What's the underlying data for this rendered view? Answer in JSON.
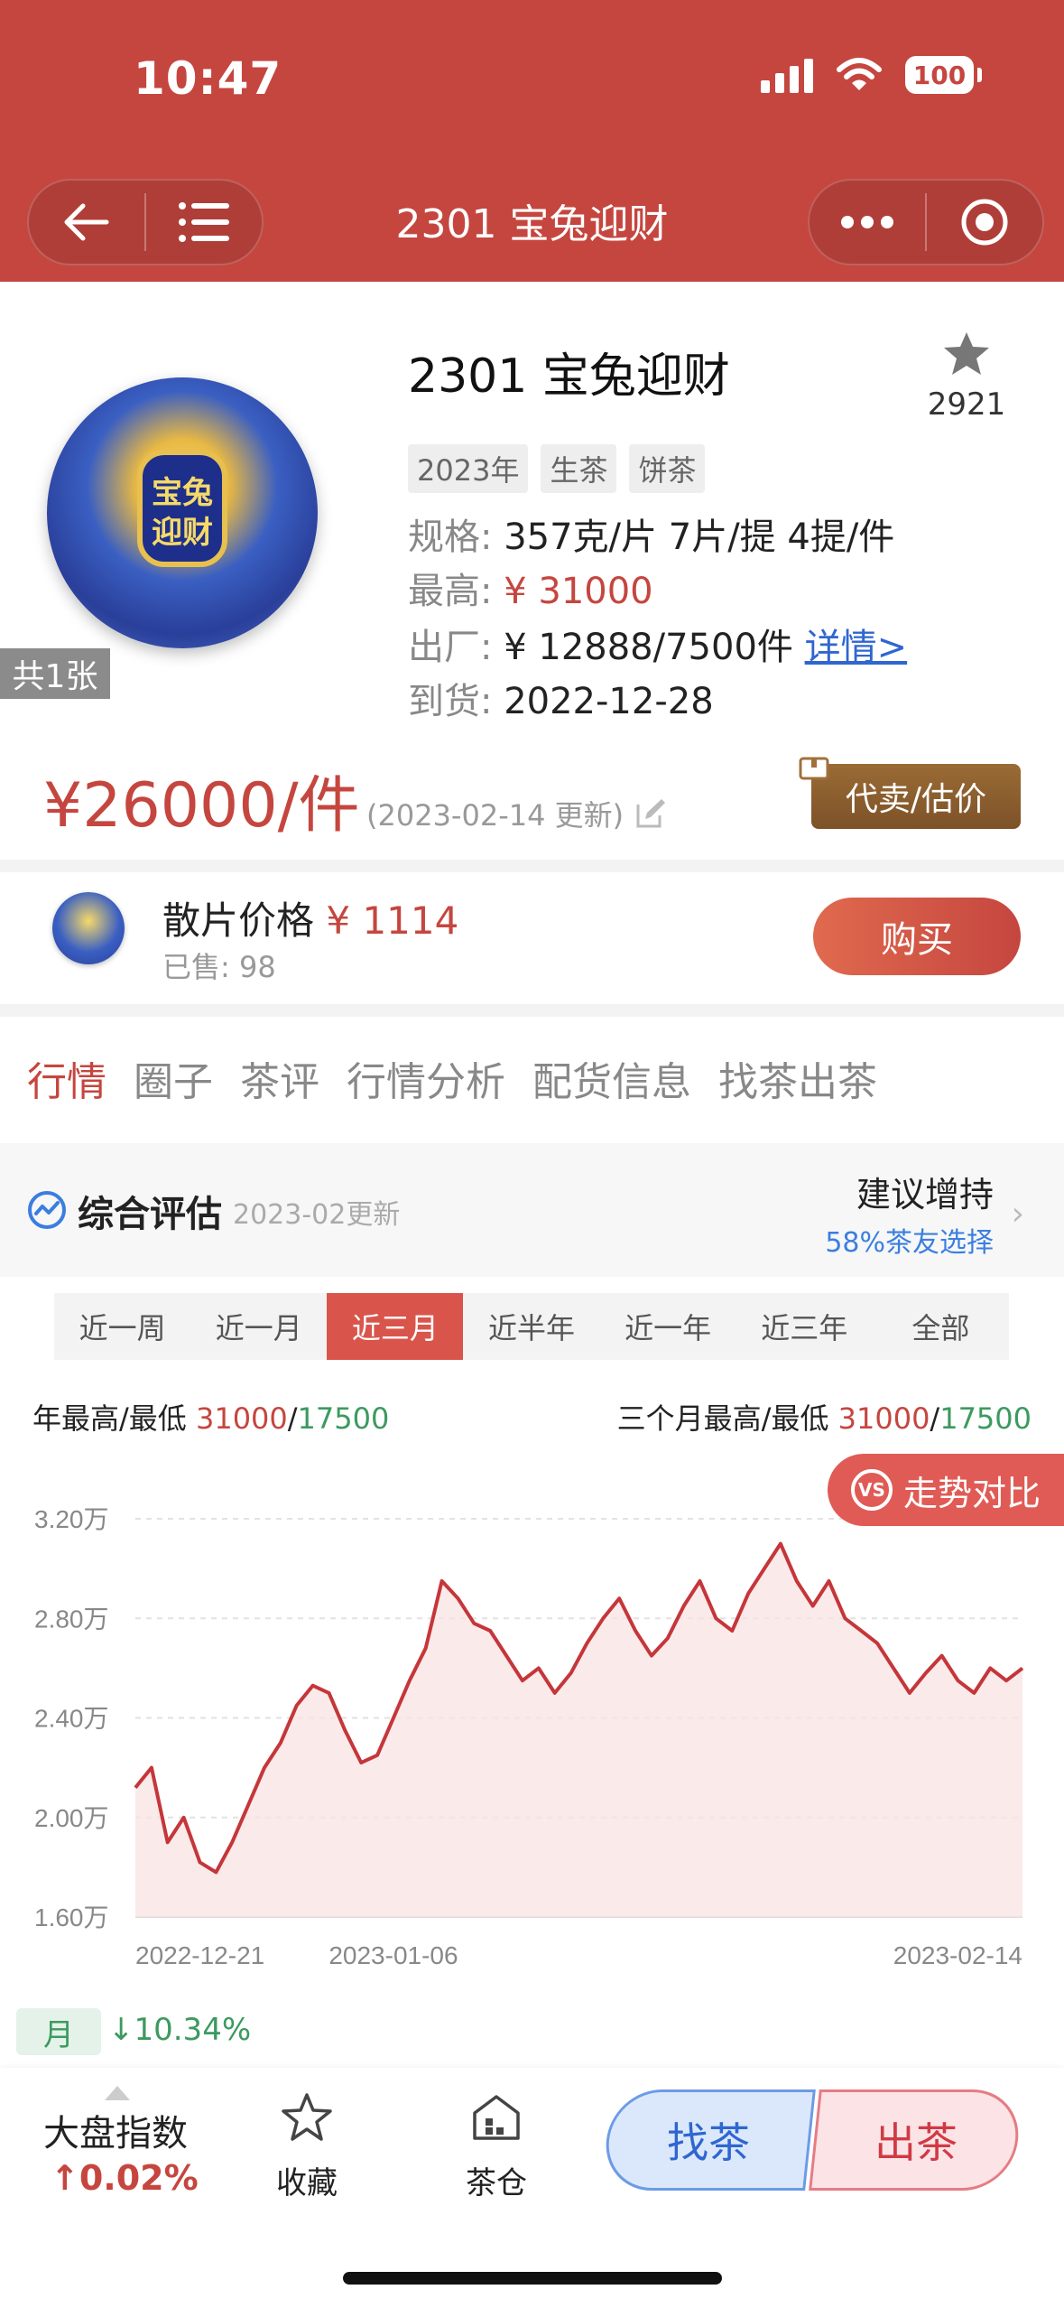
{
  "status_bar": {
    "time": "10:47",
    "battery": "100"
  },
  "nav": {
    "title": "2301 宝兔迎财"
  },
  "product": {
    "title": "2301 宝兔迎财",
    "favorite_count": "2921",
    "image_count": "共1张",
    "image_text": "宝兔迎财",
    "tags": [
      "2023年",
      "生茶",
      "饼茶"
    ],
    "spec_label": "规格:",
    "spec_value": "357克/片 7片/提 4提/件",
    "max_label": "最高:",
    "max_value": "¥ 31000",
    "factory_label": "出厂:",
    "factory_value": "¥ 12888/7500件",
    "detail_link": "详情>",
    "arrival_label": "到货:",
    "arrival_value": "2022-12-28",
    "price": "¥26000/件",
    "price_date": "(2023-02-14 更新)",
    "sell_button": "代卖/估价"
  },
  "loose": {
    "label": "散片价格",
    "price": "¥ 1114",
    "sold": "已售: 98",
    "buy_button": "购买"
  },
  "tabs": [
    {
      "label": "行情",
      "active": true
    },
    {
      "label": "圈子",
      "active": false
    },
    {
      "label": "茶评",
      "active": false
    },
    {
      "label": "行情分析",
      "active": false
    },
    {
      "label": "配货信息",
      "active": false
    },
    {
      "label": "找茶出茶",
      "active": false
    }
  ],
  "evaluation": {
    "title": "综合评估",
    "date": "2023-02更新",
    "suggest": "建议增持",
    "suggest_sub": "58%茶友选择"
  },
  "periods": [
    "近一周",
    "近一月",
    "近三月",
    "近半年",
    "近一年",
    "近三年",
    "全部"
  ],
  "active_period": 2,
  "highlow": {
    "year_label": "年最高/最低",
    "year_high": "31000",
    "year_low": "17500",
    "three_month_label": "三个月最高/最低",
    "three_month_high": "31000",
    "three_month_low": "17500",
    "sep": "/"
  },
  "trend_button": {
    "vs": "VS",
    "label": "走势对比"
  },
  "chart_data": {
    "type": "area",
    "y_ticks": [
      16000,
      20000,
      24000,
      28000,
      32000
    ],
    "y_tick_labels": [
      "1.60万",
      "2.00万",
      "2.40万",
      "2.80万",
      "3.20万"
    ],
    "ylim": [
      16000,
      32000
    ],
    "x_labels": [
      "2022-12-21",
      "2023-01-06",
      "2023-02-14"
    ],
    "x_range": [
      "2022-12-21",
      "2023-02-14"
    ],
    "grid": true,
    "colors": {
      "line": "#c5363a",
      "fill": "#f9e3e3"
    },
    "points": [
      [
        "2022-12-21",
        21200
      ],
      [
        "2022-12-22",
        22000
      ],
      [
        "2022-12-23",
        19000
      ],
      [
        "2022-12-24",
        20000
      ],
      [
        "2022-12-25",
        18200
      ],
      [
        "2022-12-26",
        17800
      ],
      [
        "2022-12-27",
        19000
      ],
      [
        "2022-12-28",
        20500
      ],
      [
        "2022-12-29",
        22000
      ],
      [
        "2022-12-30",
        23000
      ],
      [
        "2022-12-31",
        24500
      ],
      [
        "2023-01-01",
        25300
      ],
      [
        "2023-01-02",
        25000
      ],
      [
        "2023-01-03",
        23500
      ],
      [
        "2023-01-04",
        22200
      ],
      [
        "2023-01-05",
        22500
      ],
      [
        "2023-01-06",
        24000
      ],
      [
        "2023-01-07",
        25500
      ],
      [
        "2023-01-08",
        26800
      ],
      [
        "2023-01-09",
        29500
      ],
      [
        "2023-01-10",
        28800
      ],
      [
        "2023-01-11",
        27800
      ],
      [
        "2023-01-12",
        27500
      ],
      [
        "2023-01-13",
        26500
      ],
      [
        "2023-01-14",
        25500
      ],
      [
        "2023-01-15",
        26000
      ],
      [
        "2023-01-16",
        25000
      ],
      [
        "2023-01-17",
        25800
      ],
      [
        "2023-01-18",
        27000
      ],
      [
        "2023-01-19",
        28000
      ],
      [
        "2023-01-20",
        28800
      ],
      [
        "2023-01-21",
        27500
      ],
      [
        "2023-01-22",
        26500
      ],
      [
        "2023-01-23",
        27200
      ],
      [
        "2023-01-24",
        28500
      ],
      [
        "2023-01-25",
        29500
      ],
      [
        "2023-01-26",
        28000
      ],
      [
        "2023-01-27",
        27500
      ],
      [
        "2023-01-28",
        29000
      ],
      [
        "2023-01-29",
        30000
      ],
      [
        "2023-01-30",
        31000
      ],
      [
        "2023-01-31",
        29500
      ],
      [
        "2023-02-01",
        28500
      ],
      [
        "2023-02-02",
        29500
      ],
      [
        "2023-02-03",
        28000
      ],
      [
        "2023-02-04",
        27500
      ],
      [
        "2023-02-05",
        27000
      ],
      [
        "2023-02-06",
        26000
      ],
      [
        "2023-02-07",
        25000
      ],
      [
        "2023-02-08",
        25800
      ],
      [
        "2023-02-09",
        26500
      ],
      [
        "2023-02-10",
        25500
      ],
      [
        "2023-02-11",
        25000
      ],
      [
        "2023-02-12",
        26000
      ],
      [
        "2023-02-13",
        25500
      ],
      [
        "2023-02-14",
        26000
      ]
    ]
  },
  "month": {
    "badge": "月",
    "change": "↓10.34%"
  },
  "bottom": {
    "index_label": "大盘指数",
    "index_value": "↑0.02%",
    "favorite_label": "收藏",
    "warehouse_label": "茶仓",
    "find_button": "找茶",
    "sell_button": "出茶"
  }
}
